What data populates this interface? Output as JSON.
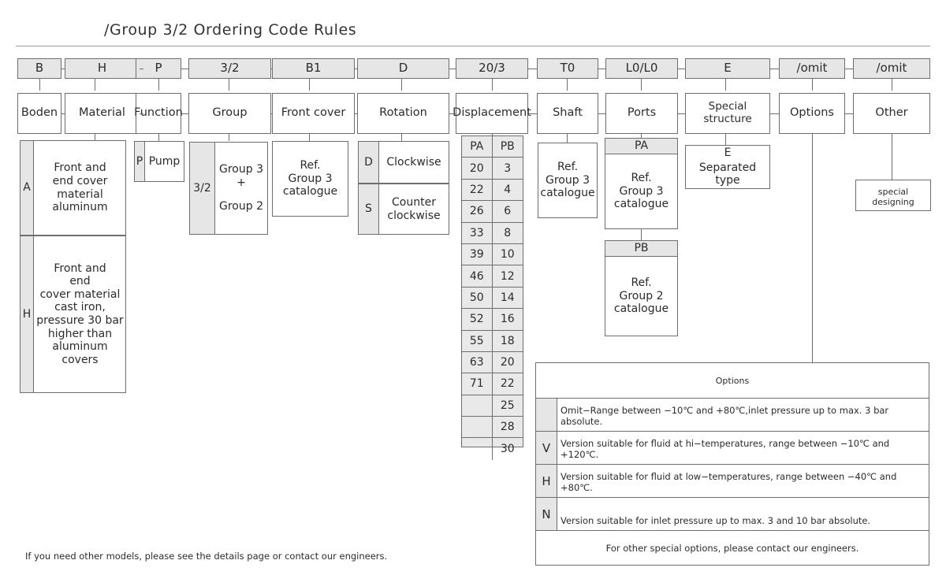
{
  "page": {
    "title": "/Group 3/2 Ordering Code Rules",
    "footer_note": "If you need other models, please see the details page or contact our engineers."
  },
  "columns": [
    {
      "code": "B",
      "label": "Boden"
    },
    {
      "code": "H",
      "label": "Material"
    },
    {
      "code": "P",
      "label": "Function"
    },
    {
      "code": "3/2",
      "label": "Group"
    },
    {
      "code": "B1",
      "label": "Front cover"
    },
    {
      "code": "D",
      "label": "Rotation"
    },
    {
      "code": "20/3",
      "label": "Displacement"
    },
    {
      "code": "T0",
      "label": "Shaft"
    },
    {
      "code": "L0/L0",
      "label": "Ports"
    },
    {
      "code": "E",
      "label": "Special structure"
    },
    {
      "code": "/omit",
      "label": "Options"
    },
    {
      "code": "/omit",
      "label": "Other"
    }
  ],
  "material": {
    "rows": [
      {
        "key": "A",
        "lines": [
          "Front  and",
          "end  cover",
          "material",
          "aluminum"
        ]
      },
      {
        "key": "H",
        "lines": [
          "Front  and",
          "end",
          "cover  material",
          "cast  iron,",
          "pressure  30  bar",
          "higher  than",
          "aluminum  covers"
        ]
      }
    ]
  },
  "function": {
    "rows": [
      {
        "key": "P",
        "lines": [
          "Pump"
        ]
      }
    ]
  },
  "group": {
    "rows": [
      {
        "key": "3/2",
        "lines": [
          "Group  3",
          "+",
          "",
          "Group  2"
        ]
      }
    ]
  },
  "front_cover": {
    "lines": [
      "Ref.",
      "Group  3",
      "catalogue"
    ]
  },
  "rotation": {
    "rows": [
      {
        "key": "D",
        "lines": [
          "Clockwise"
        ]
      },
      {
        "key": "S",
        "lines": [
          "Counter",
          "clockwise"
        ]
      }
    ]
  },
  "displacement": {
    "headers": [
      "PA",
      "PB"
    ],
    "rows": [
      [
        "20",
        "3"
      ],
      [
        "22",
        "4"
      ],
      [
        "26",
        "6"
      ],
      [
        "33",
        "8"
      ],
      [
        "39",
        "10"
      ],
      [
        "46",
        "12"
      ],
      [
        "50",
        "14"
      ],
      [
        "52",
        "16"
      ],
      [
        "55",
        "18"
      ],
      [
        "63",
        "20"
      ],
      [
        "71",
        "22"
      ],
      [
        "",
        "25"
      ],
      [
        "",
        "28"
      ],
      [
        "",
        "30"
      ]
    ]
  },
  "shaft": {
    "lines": [
      "Ref.",
      "Group  3",
      "catalogue"
    ]
  },
  "ports": {
    "blocks": [
      {
        "header": "PA",
        "lines": [
          "Ref.",
          "Group  3",
          "catalogue"
        ]
      },
      {
        "header": "PB",
        "lines": [
          "Ref.",
          "Group  2",
          "catalogue"
        ]
      }
    ]
  },
  "special_structure": {
    "code": "E",
    "text": "Separated  type"
  },
  "other": {
    "text": "special  designing"
  },
  "options_table": {
    "header": "Options",
    "rows": [
      {
        "key": "",
        "text": "Omit−Range  between  −10℃  and  +80℃,inlet  pressure  up  to  max.  3  bar  absolute."
      },
      {
        "key": "V",
        "text": "Version  suitable  for  fluid  at  hi−temperatures,  range  between  −10℃  and  +120℃."
      },
      {
        "key": "H",
        "text": "Version  suitable  for  fluid  at  low−temperatures,  range  between  −40℃  and  +80℃."
      },
      {
        "key": "N",
        "text": "Version  suitable  for  inlet  pressure  up  to  max.  3  and  10  bar  absolute."
      }
    ],
    "footer": "For  other  special  options,  please  contact  our  engineers."
  },
  "colors": {
    "line": "#6e6e6e",
    "shade": "#e6e6e6",
    "text": "#2b2b2b",
    "background": "#ffffff"
  }
}
